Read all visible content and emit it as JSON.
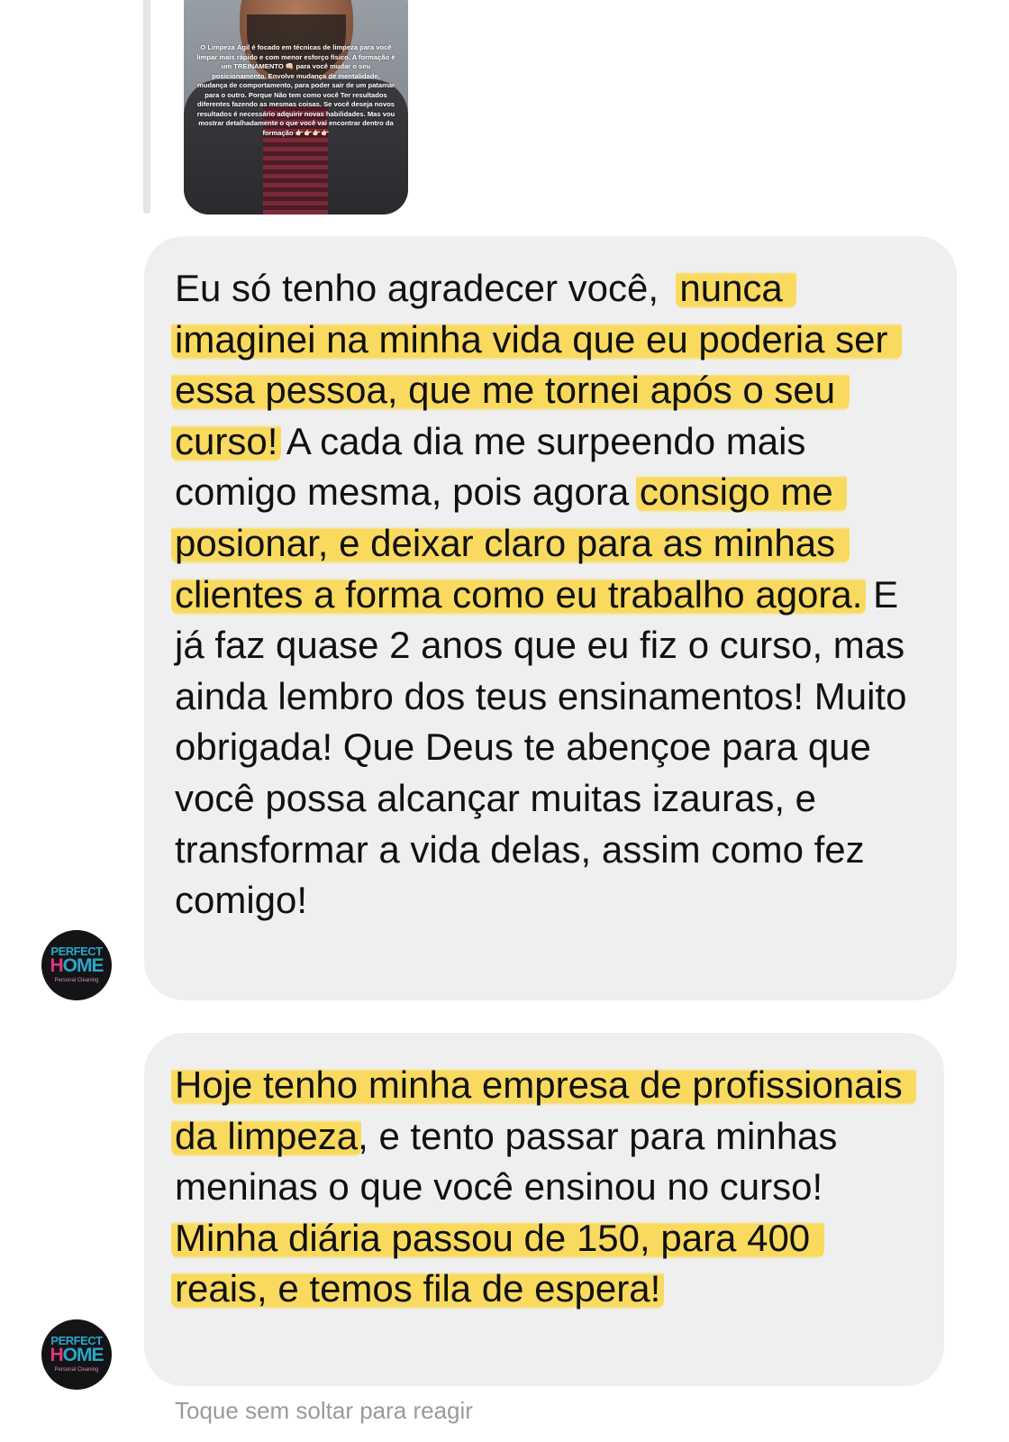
{
  "thread": {
    "story_reply": {
      "caption": "O Limpeza Ágil é focado em técnicas de limpeza para você limpar mais rápido e com menor esforço físico. A formação é um TREINAMENTO 👊🏻 para você mudar o seu posicionamento. Envolve mudança de mentalidade, mudança de comportamento, para poder sair de um patamar para o outro. Porque Não tem como você Ter resultados diferentes fazendo as mesmas coisas. Se você deseja novos resultados é necessário adquirir novas habilidades. Mas vou mostrar detalhadamente o que você vai encontrar dentro da formação 👉🏻👉🏻👉🏻👉🏻"
    },
    "avatar": {
      "line1": "PERFECT",
      "line2_h": "H",
      "line2_rest": "OME",
      "line3": "Personal Cleaning"
    },
    "messages": [
      {
        "segments": [
          {
            "text": "Eu só tenho agradecer você,  ",
            "highlight": false
          },
          {
            "text": "nunca imaginei na minha vida que eu poderia ser essa pessoa, que me tornei após o seu curso!",
            "highlight": true
          },
          {
            "text": " A cada dia me surpeendo mais comigo mesma, pois agora ",
            "highlight": false
          },
          {
            "text": "consigo me posionar, e deixar claro para as minhas clientes a forma como eu trabalho agora.",
            "highlight": true
          },
          {
            "text": " E já faz quase 2 anos que eu fiz o curso, mas ainda lembro dos teus ensinamentos! Muito obrigada! Que Deus te abençoe para que você possa alcançar muitas izauras, e transformar a vida delas, assim como fez comigo!",
            "highlight": false
          }
        ]
      },
      {
        "segments": [
          {
            "text": "Hoje tenho minha empresa de profissionais da limpeza",
            "highlight": true
          },
          {
            "text": ", e tento passar para minhas meninas o que você ensinou no curso! ",
            "highlight": false
          },
          {
            "text": "Minha diária passou de 150, para 400 reais, e temos fila de espera!",
            "highlight": true
          }
        ]
      }
    ],
    "hint": "Toque sem soltar para reagir"
  },
  "colors": {
    "bubble": "#efefef",
    "highlight": "#fbd63e",
    "avatar_teal": "#2aa7c9",
    "avatar_pink": "#e0357f"
  }
}
